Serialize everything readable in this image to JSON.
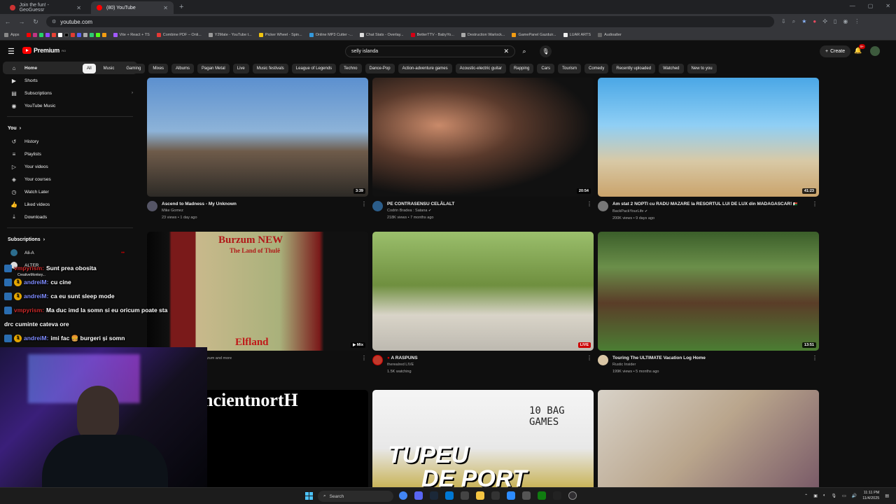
{
  "browser": {
    "tabs": [
      {
        "title": "Join the fun! - GeoGuessr",
        "active": false
      },
      {
        "title": "(80) YouTube",
        "active": true
      }
    ],
    "url": "youtube.com",
    "bookmarks": [
      "Apps",
      "Vite + React + TS",
      "Combine PDF – Onli...",
      "Y2Mate - YouTube t...",
      "Picker Wheel - Spin...",
      "Online MP3 Cutter -...",
      "Chat Stats - Overlay...",
      "BetterTTV - BabyYo...",
      "Destruction Warlock...",
      "GamePanel Gazduir...",
      "LUAR ARTS",
      "Audioalter"
    ]
  },
  "header": {
    "logo": "Premium",
    "logo_sup": "RO",
    "search_value": "selly islanda",
    "create_label": "Create",
    "notif_count": "9+"
  },
  "sidebar": {
    "main": [
      {
        "label": "Home",
        "icon": "home-icon",
        "active": true
      },
      {
        "label": "Shorts",
        "icon": "shorts-icon"
      },
      {
        "label": "Subscriptions",
        "icon": "subscriptions-icon"
      },
      {
        "label": "YouTube Music",
        "icon": "music-icon"
      }
    ],
    "you_title": "You",
    "you": [
      {
        "label": "History",
        "icon": "history-icon"
      },
      {
        "label": "Playlists",
        "icon": "playlists-icon"
      },
      {
        "label": "Your videos",
        "icon": "video-icon"
      },
      {
        "label": "Your courses",
        "icon": "courses-icon"
      },
      {
        "label": "Watch Later",
        "icon": "clock-icon"
      },
      {
        "label": "Liked videos",
        "icon": "like-icon"
      },
      {
        "label": "Downloads",
        "icon": "download-icon"
      }
    ],
    "subs_title": "Subscriptions",
    "subs": [
      {
        "label": "Ali-A"
      },
      {
        "label": "ALTER"
      },
      {
        "label": "CreativeMonkey..."
      }
    ]
  },
  "chips": [
    "All",
    "Music",
    "Gaming",
    "Mixes",
    "Albums",
    "Pagan Metal",
    "Live",
    "Music festivals",
    "League of Legends",
    "Techno",
    "Dance-Pop",
    "Action-adventure games",
    "Acoustic-electric guitar",
    "Rapping",
    "Cars",
    "Tourism",
    "Comedy",
    "Recently uploaded",
    "Watched",
    "New to you"
  ],
  "videos": [
    {
      "title": "Ascend to Madness - My Unknown",
      "channel": "Mike Gomez",
      "stats": "23 views • 1 day ago",
      "duration": "3:39"
    },
    {
      "title": "PE CONTRASENSU CELĂLALT",
      "channel": "Codrin Bradea : Satana",
      "stats": "218K views • 7 months ago",
      "duration": "20:54"
    },
    {
      "title": "Am stat 2 NOPTI cu RADU MAZARE la RESORTUL LUI DE LUX din MADAGASCAR! ",
      "channel": "BackPackYourLife",
      "stats": "200K views • 9 days ago",
      "duration": "41:23"
    },
    {
      "title": "",
      "channel": "",
      "stats": "urzum and more",
      "duration": "Mix",
      "thumb_title": "Burzum NEW",
      "thumb_sub": "The Land of Thulê",
      "thumb_bottom": "Elfland"
    },
    {
      "title": "A RASPUNS",
      "channel": "therealred LIVE",
      "stats": "1.5K watching",
      "duration": "LIVE"
    },
    {
      "title": "Touring The ULTIMATE Vacation Log Home",
      "channel": "Rustic Insider",
      "stats": "199K views • 5 months ago",
      "duration": "13:51"
    },
    {
      "thumb_text": "ncientnortH"
    },
    {
      "thumb_text": "TUPEU",
      "thumb_text2": "DE PORT",
      "thumb_note": "10 BAG GAMES"
    },
    {
      "thumb_text": ""
    }
  ],
  "chat": [
    {
      "user": "vmpyrism:",
      "msg": "Sunt prea obosita",
      "color": "red"
    },
    {
      "user": "andreiM:",
      "msg": "cu cine",
      "color": "blue"
    },
    {
      "user": "andreiM:",
      "msg": "ca eu sunt sleep mode",
      "color": "blue"
    },
    {
      "user": "vmpyrism:",
      "msg": "Ma duc imd la somn si eu oricum poate sta",
      "color": "red"
    },
    {
      "user": "",
      "msg": "drc cuminte cateva ore",
      "color": ""
    },
    {
      "user": "andreiM:",
      "msg": "imi fac 🍔 burgeri și somn",
      "color": "blue"
    }
  ],
  "taskbar": {
    "search_label": "Search",
    "time": "11:11 PM",
    "date": "11/4/2025"
  }
}
